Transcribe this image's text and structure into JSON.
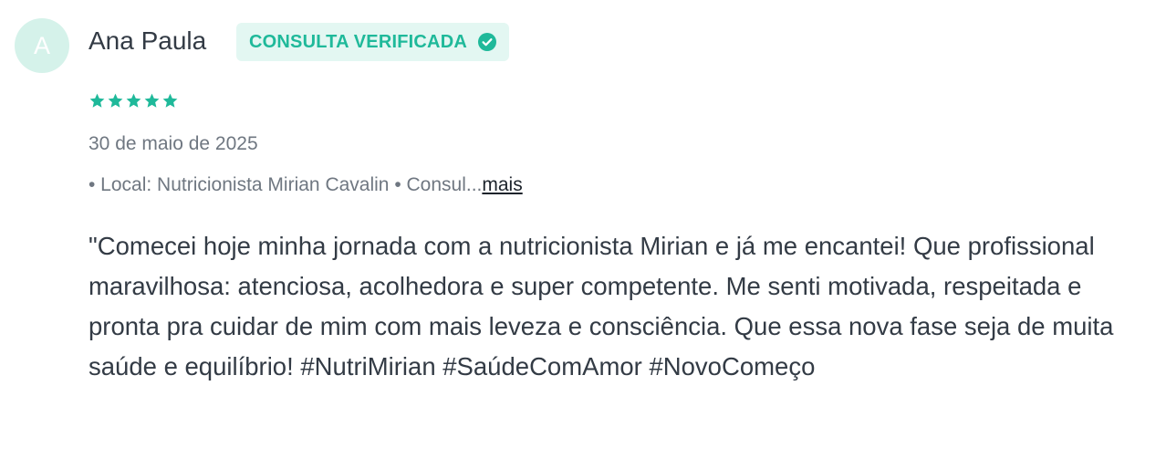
{
  "review": {
    "avatar_letter": "A",
    "author_name": "Ana Paula",
    "badge_label": "CONSULTA VERIFICADA",
    "badge_icon": "check-circle-icon",
    "rating": 5,
    "rating_max": 5,
    "date": "30 de maio de 2025",
    "meta_text": "• Local: Nutricionista Mirian Cavalin • Consul...",
    "more_label": "mais",
    "text": "\"Comecei hoje minha jornada com a nutricionista Mirian e já me encantei! Que profissional maravilhosa: atenciosa, acolhedora e super competente. Me senti motivada, respeitada e pronta pra cuidar de mim com mais leveza e consciência. Que essa nova fase seja de muita saúde e equilíbrio! #NutriMirian #SaúdeComAmor #NovoComeço"
  },
  "colors": {
    "accent": "#1fb99a",
    "badge_background": "#e3f7f2",
    "avatar_background": "#d5f2ea",
    "text": "#333b45",
    "muted_text": "#6f7781"
  }
}
